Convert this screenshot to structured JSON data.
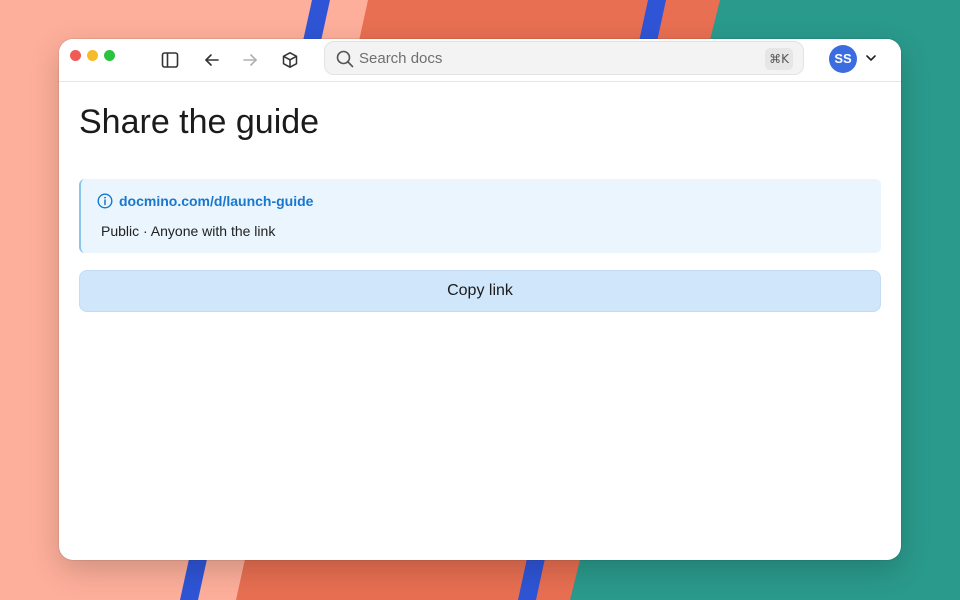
{
  "toolbar": {
    "search_placeholder": "Search docs",
    "search_value": "",
    "search_shortcut": "⌘K",
    "avatar_initials": "SS",
    "icons": {
      "sidebar": "sidebar-toggle-icon",
      "back": "arrow-left-icon",
      "forward": "arrow-right-icon",
      "package": "box-icon",
      "search": "search-icon",
      "avatar_menu": "chevron-down-icon"
    }
  },
  "main": {
    "title": "Share the guide",
    "share": {
      "link": "docmino.com/d/launch-guide",
      "description": "Public · Anyone with the link"
    },
    "copy_button_label": "Copy link"
  },
  "colors": {
    "accent": "#1877cf",
    "card_background": "#eaf5fd",
    "button_background": "#cfe6fb",
    "avatar": "#3b6ce0"
  }
}
